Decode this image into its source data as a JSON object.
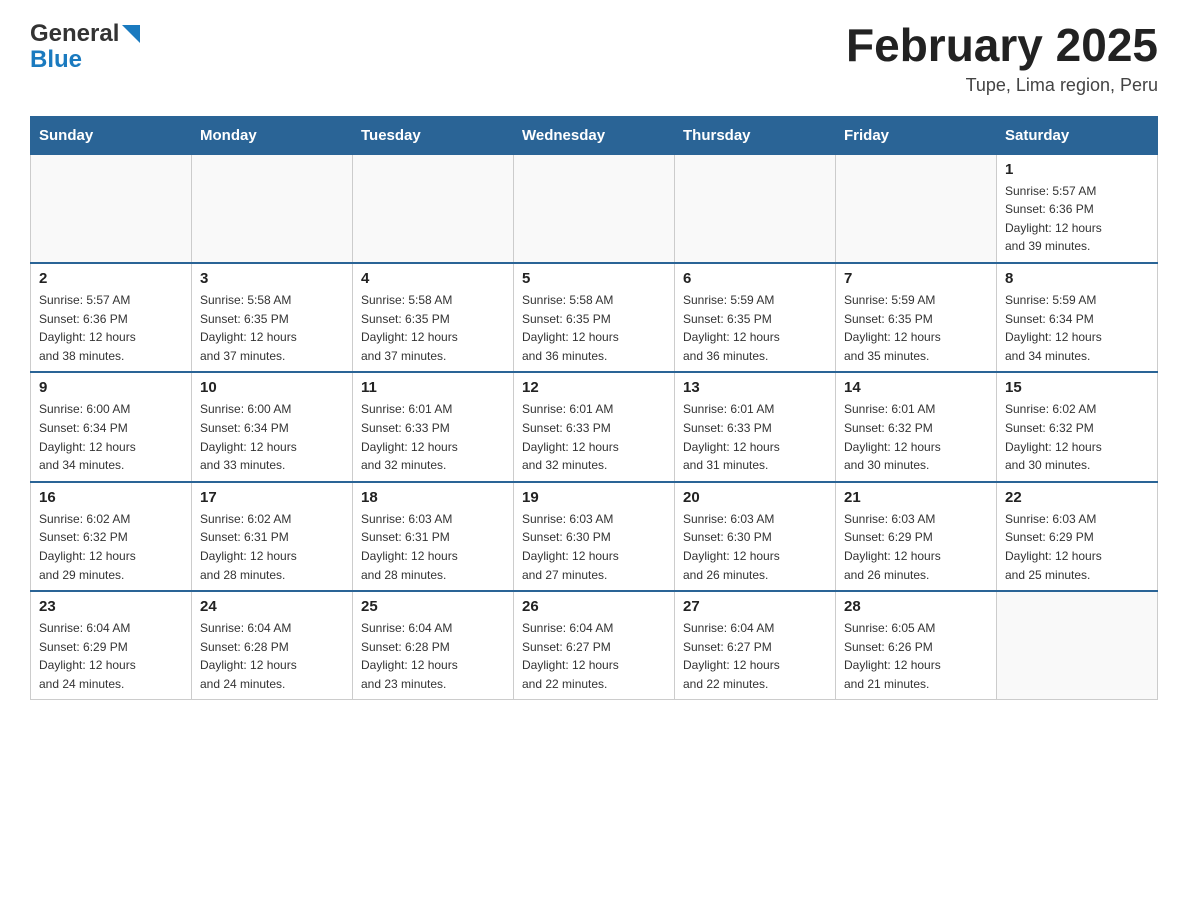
{
  "header": {
    "logo_general": "General",
    "logo_blue": "Blue",
    "month_title": "February 2025",
    "subtitle": "Tupe, Lima region, Peru"
  },
  "weekdays": [
    "Sunday",
    "Monday",
    "Tuesday",
    "Wednesday",
    "Thursday",
    "Friday",
    "Saturday"
  ],
  "weeks": [
    [
      {
        "day": "",
        "info": ""
      },
      {
        "day": "",
        "info": ""
      },
      {
        "day": "",
        "info": ""
      },
      {
        "day": "",
        "info": ""
      },
      {
        "day": "",
        "info": ""
      },
      {
        "day": "",
        "info": ""
      },
      {
        "day": "1",
        "info": "Sunrise: 5:57 AM\nSunset: 6:36 PM\nDaylight: 12 hours\nand 39 minutes."
      }
    ],
    [
      {
        "day": "2",
        "info": "Sunrise: 5:57 AM\nSunset: 6:36 PM\nDaylight: 12 hours\nand 38 minutes."
      },
      {
        "day": "3",
        "info": "Sunrise: 5:58 AM\nSunset: 6:35 PM\nDaylight: 12 hours\nand 37 minutes."
      },
      {
        "day": "4",
        "info": "Sunrise: 5:58 AM\nSunset: 6:35 PM\nDaylight: 12 hours\nand 37 minutes."
      },
      {
        "day": "5",
        "info": "Sunrise: 5:58 AM\nSunset: 6:35 PM\nDaylight: 12 hours\nand 36 minutes."
      },
      {
        "day": "6",
        "info": "Sunrise: 5:59 AM\nSunset: 6:35 PM\nDaylight: 12 hours\nand 36 minutes."
      },
      {
        "day": "7",
        "info": "Sunrise: 5:59 AM\nSunset: 6:35 PM\nDaylight: 12 hours\nand 35 minutes."
      },
      {
        "day": "8",
        "info": "Sunrise: 5:59 AM\nSunset: 6:34 PM\nDaylight: 12 hours\nand 34 minutes."
      }
    ],
    [
      {
        "day": "9",
        "info": "Sunrise: 6:00 AM\nSunset: 6:34 PM\nDaylight: 12 hours\nand 34 minutes."
      },
      {
        "day": "10",
        "info": "Sunrise: 6:00 AM\nSunset: 6:34 PM\nDaylight: 12 hours\nand 33 minutes."
      },
      {
        "day": "11",
        "info": "Sunrise: 6:01 AM\nSunset: 6:33 PM\nDaylight: 12 hours\nand 32 minutes."
      },
      {
        "day": "12",
        "info": "Sunrise: 6:01 AM\nSunset: 6:33 PM\nDaylight: 12 hours\nand 32 minutes."
      },
      {
        "day": "13",
        "info": "Sunrise: 6:01 AM\nSunset: 6:33 PM\nDaylight: 12 hours\nand 31 minutes."
      },
      {
        "day": "14",
        "info": "Sunrise: 6:01 AM\nSunset: 6:32 PM\nDaylight: 12 hours\nand 30 minutes."
      },
      {
        "day": "15",
        "info": "Sunrise: 6:02 AM\nSunset: 6:32 PM\nDaylight: 12 hours\nand 30 minutes."
      }
    ],
    [
      {
        "day": "16",
        "info": "Sunrise: 6:02 AM\nSunset: 6:32 PM\nDaylight: 12 hours\nand 29 minutes."
      },
      {
        "day": "17",
        "info": "Sunrise: 6:02 AM\nSunset: 6:31 PM\nDaylight: 12 hours\nand 28 minutes."
      },
      {
        "day": "18",
        "info": "Sunrise: 6:03 AM\nSunset: 6:31 PM\nDaylight: 12 hours\nand 28 minutes."
      },
      {
        "day": "19",
        "info": "Sunrise: 6:03 AM\nSunset: 6:30 PM\nDaylight: 12 hours\nand 27 minutes."
      },
      {
        "day": "20",
        "info": "Sunrise: 6:03 AM\nSunset: 6:30 PM\nDaylight: 12 hours\nand 26 minutes."
      },
      {
        "day": "21",
        "info": "Sunrise: 6:03 AM\nSunset: 6:29 PM\nDaylight: 12 hours\nand 26 minutes."
      },
      {
        "day": "22",
        "info": "Sunrise: 6:03 AM\nSunset: 6:29 PM\nDaylight: 12 hours\nand 25 minutes."
      }
    ],
    [
      {
        "day": "23",
        "info": "Sunrise: 6:04 AM\nSunset: 6:29 PM\nDaylight: 12 hours\nand 24 minutes."
      },
      {
        "day": "24",
        "info": "Sunrise: 6:04 AM\nSunset: 6:28 PM\nDaylight: 12 hours\nand 24 minutes."
      },
      {
        "day": "25",
        "info": "Sunrise: 6:04 AM\nSunset: 6:28 PM\nDaylight: 12 hours\nand 23 minutes."
      },
      {
        "day": "26",
        "info": "Sunrise: 6:04 AM\nSunset: 6:27 PM\nDaylight: 12 hours\nand 22 minutes."
      },
      {
        "day": "27",
        "info": "Sunrise: 6:04 AM\nSunset: 6:27 PM\nDaylight: 12 hours\nand 22 minutes."
      },
      {
        "day": "28",
        "info": "Sunrise: 6:05 AM\nSunset: 6:26 PM\nDaylight: 12 hours\nand 21 minutes."
      },
      {
        "day": "",
        "info": ""
      }
    ]
  ]
}
